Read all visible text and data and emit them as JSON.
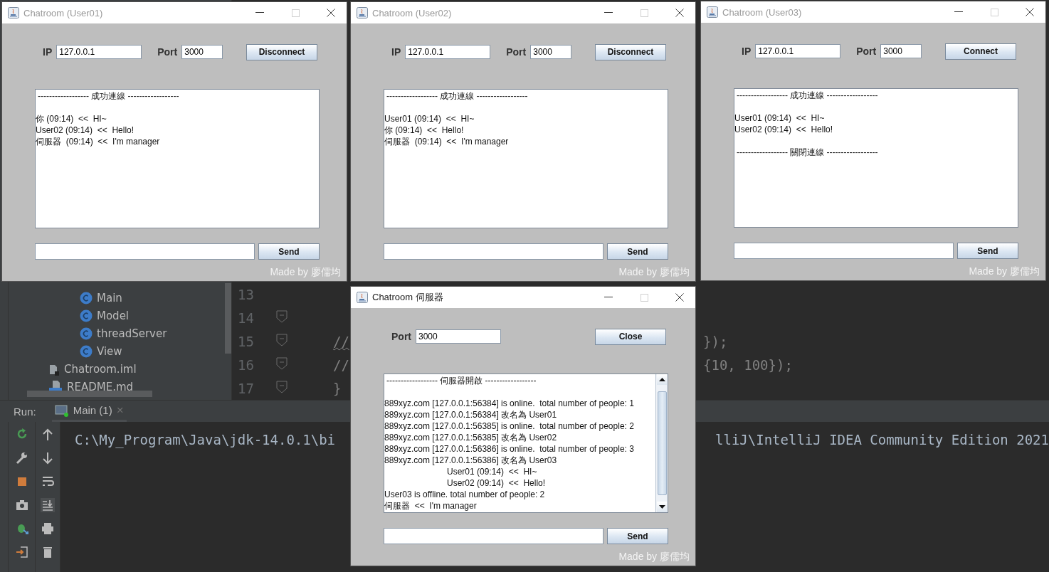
{
  "ide": {
    "project_items": [
      {
        "label": "Main",
        "kind": "class"
      },
      {
        "label": "Model",
        "kind": "class"
      },
      {
        "label": "threadServer",
        "kind": "class"
      },
      {
        "label": "View",
        "kind": "class"
      },
      {
        "label": "Chatroom.iml",
        "kind": "iml"
      },
      {
        "label": "README.md",
        "kind": "md"
      }
    ],
    "code_lines": [
      {
        "number": "13"
      },
      {
        "number": "14"
      },
      {
        "number": "15",
        "text": "//",
        "tail": "});"
      },
      {
        "number": "16",
        "text": "//",
        "tail": "{10, 100});"
      },
      {
        "number": "17",
        "text": "}"
      }
    ],
    "run_label": "Run:",
    "run_tab": "Main (1)",
    "run_tab_close": "×",
    "console": [
      "C:\\My_Program\\Java\\jdk-14.0.1\\bi",
      "lliJ\\IntelliJ IDEA Community Edition 2021"
    ]
  },
  "windows": [
    {
      "title": "Chatroom (User01)",
      "active": false,
      "ip_label": "IP",
      "ip": "127.0.0.1",
      "port_label": "Port",
      "port": "3000",
      "button": "Disconnect",
      "has_scrollbar": false,
      "send": "Send",
      "footer": "Made by 廖儒均",
      "log": [
        {
          "kind": "divider",
          "text": "------------------ 成功連線 ------------------"
        },
        {
          "kind": "blank"
        },
        {
          "kind": "message",
          "text": "你 (09:14)  <<  HI~"
        },
        {
          "kind": "message",
          "text": "User02 (09:14)  <<  Hello!"
        },
        {
          "kind": "message",
          "text": "伺服器  (09:14)  <<  I'm manager"
        }
      ]
    },
    {
      "title": "Chatroom (User02)",
      "active": false,
      "ip_label": "IP",
      "ip": "127.0.0.1",
      "port_label": "Port",
      "port": "3000",
      "button": "Disconnect",
      "has_scrollbar": false,
      "send": "Send",
      "footer": "Made by 廖儒均",
      "log": [
        {
          "kind": "divider",
          "text": "------------------ 成功連線 ------------------"
        },
        {
          "kind": "blank"
        },
        {
          "kind": "message",
          "text": "User01 (09:14)  <<  HI~"
        },
        {
          "kind": "message",
          "text": "你 (09:14)  <<  Hello!"
        },
        {
          "kind": "message",
          "text": "伺服器  (09:14)  <<  I'm manager"
        }
      ]
    },
    {
      "title": "Chatroom (User03)",
      "active": false,
      "ip_label": "IP",
      "ip": "127.0.0.1",
      "port_label": "Port",
      "port": "3000",
      "button": "Connect",
      "has_scrollbar": false,
      "send": "Send",
      "footer": "Made by 廖儒均",
      "log": [
        {
          "kind": "divider",
          "text": "------------------ 成功連線 ------------------"
        },
        {
          "kind": "blank"
        },
        {
          "kind": "message",
          "text": "User01 (09:14)  <<  HI~"
        },
        {
          "kind": "message",
          "text": "User02 (09:14)  <<  Hello!"
        },
        {
          "kind": "blank"
        },
        {
          "kind": "divider",
          "text": "------------------ 關閉連線 ------------------"
        }
      ]
    },
    {
      "title": "Chatroom 伺服器",
      "active": true,
      "port_label": "Port",
      "port": "3000",
      "button": "Close",
      "has_scrollbar": true,
      "send": "Send",
      "footer": "Made by 廖儒均",
      "log": [
        {
          "kind": "divider",
          "text": "------------------ 伺服器開啟 ------------------"
        },
        {
          "kind": "blank"
        },
        {
          "kind": "message",
          "text": "889xyz.com [127.0.0.1:56384] is online.  total number of people: 1"
        },
        {
          "kind": "message",
          "text": "889xyz.com [127.0.0.1:56384] 改名為 User01"
        },
        {
          "kind": "message",
          "text": "889xyz.com [127.0.0.1:56385] is online.  total number of people: 2"
        },
        {
          "kind": "message",
          "text": "889xyz.com [127.0.0.1:56385] 改名為 User02"
        },
        {
          "kind": "message",
          "text": "889xyz.com [127.0.0.1:56386] is online.  total number of people: 3"
        },
        {
          "kind": "message",
          "text": "889xyz.com [127.0.0.1:56386] 改名為 User03"
        },
        {
          "kind": "relayed",
          "text": "User01 (09:14)  <<  HI~"
        },
        {
          "kind": "relayed",
          "text": "User02 (09:14)  <<  Hello!"
        },
        {
          "kind": "message",
          "text": "User03 is offline. total number of people: 2"
        },
        {
          "kind": "message",
          "text": "伺服器  <<  I'm manager"
        }
      ]
    }
  ]
}
